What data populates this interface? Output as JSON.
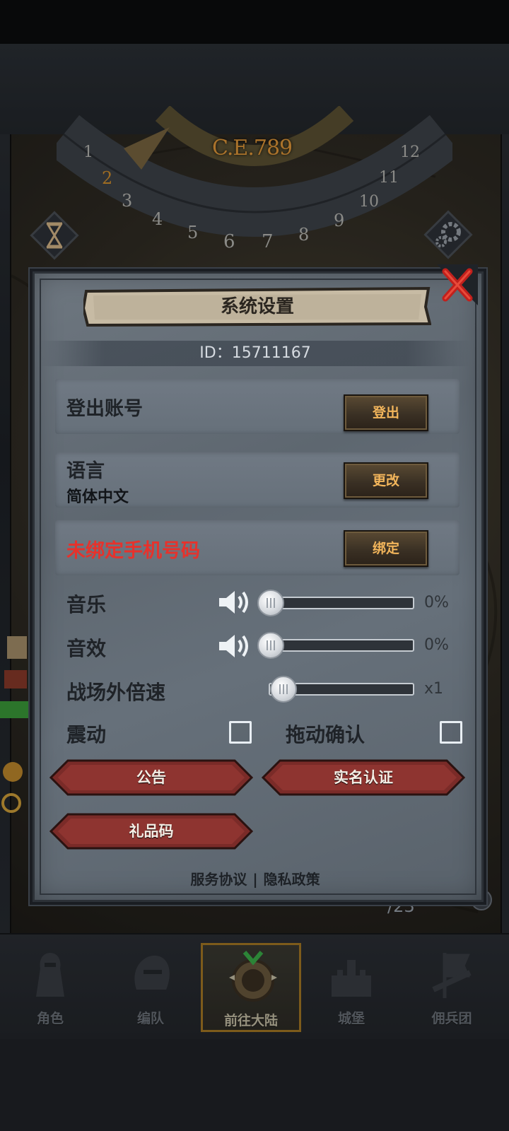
{
  "background": {
    "calendar_year": "C.E.789",
    "wheel_numbers": [
      "1",
      "2",
      "3",
      "4",
      "5",
      "6",
      "7",
      "8",
      "9",
      "10",
      "11",
      "12"
    ],
    "resource_count": "/23"
  },
  "nav": {
    "items": [
      {
        "label": "角色",
        "icon": "knight-icon"
      },
      {
        "label": "编队",
        "icon": "helmet-icon"
      },
      {
        "label": "前往大陆",
        "icon": "globe-icon",
        "active": true
      },
      {
        "label": "城堡",
        "icon": "castle-icon"
      },
      {
        "label": "佣兵团",
        "icon": "banner-icon"
      }
    ]
  },
  "dialog": {
    "title": "系统设置",
    "id_text": "ID：15711167",
    "logout": {
      "label": "登出账号",
      "button": "登出"
    },
    "language": {
      "label": "语言",
      "value": "简体中文",
      "button": "更改"
    },
    "phone": {
      "label": "未绑定手机号码",
      "button": "绑定"
    },
    "music": {
      "label": "音乐",
      "value_text": "0%",
      "level": 0
    },
    "sfx": {
      "label": "音效",
      "value_text": "0%",
      "level": 0
    },
    "speed": {
      "label": "战场外倍速",
      "value_text": "x1",
      "level": 0
    },
    "vibration": {
      "label": "震动",
      "checked": false
    },
    "drag_confirm": {
      "label": "拖动确认",
      "checked": false
    },
    "buttons": {
      "notice": "公告",
      "realname": "实名认证",
      "gift": "礼品码"
    },
    "footer": {
      "service": "服务协议",
      "sep": "|",
      "privacy": "隐私政策"
    }
  },
  "colors": {
    "warning": "#e6322c",
    "gold": "#f2b55b",
    "accent_border": "#a77a25"
  }
}
